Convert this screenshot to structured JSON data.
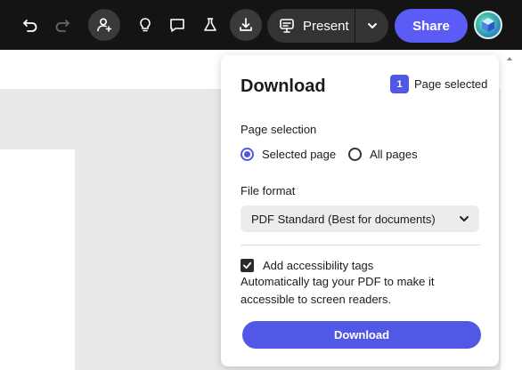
{
  "toolbar": {
    "present_label": "Present",
    "share_label": "Share",
    "icons": [
      "undo-icon",
      "redo-icon",
      "add-user-icon",
      "lightbulb-icon",
      "comment-icon",
      "flask-icon",
      "download-icon",
      "present-icon",
      "chevron-down-icon"
    ]
  },
  "panel": {
    "title": "Download",
    "selected_count": "1",
    "selected_label": "Page selected",
    "page_selection_label": "Page selection",
    "options": [
      {
        "label": "Selected page",
        "selected": true
      },
      {
        "label": "All pages",
        "selected": false
      }
    ],
    "file_format_label": "File format",
    "file_format_value": "PDF Standard (Best for documents)",
    "accessibility_label": "Add accessibility tags",
    "accessibility_checked": true,
    "accessibility_help": "Automatically tag your PDF to make it accessible to screen readers.",
    "download_button": "Download"
  },
  "colors": {
    "accent": "#5258e6",
    "share": "#5b5bf5",
    "toolbar_bg": "#141414"
  }
}
